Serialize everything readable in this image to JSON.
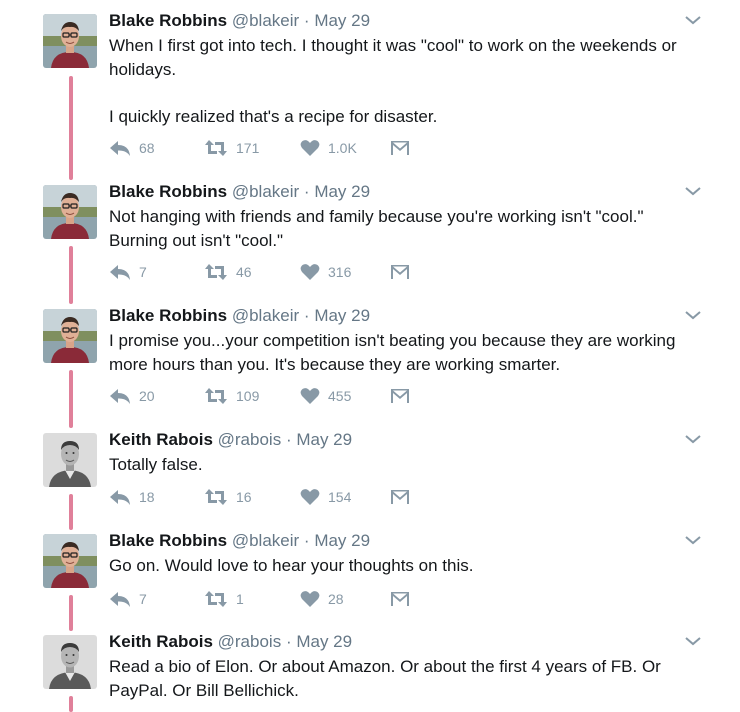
{
  "tweets": [
    {
      "name": "Blake Robbins",
      "handle": "@blakeir",
      "separator": "·",
      "date": "May 29",
      "text": "When I first got into tech. I thought it was \"cool\" to work on the weekends or holidays.\n\nI quickly realized that's a recipe for disaster.",
      "replies": "68",
      "retweets": "171",
      "likes": "1.0K",
      "avatar": "blake-avatar"
    },
    {
      "name": "Blake Robbins",
      "handle": "@blakeir",
      "separator": "·",
      "date": "May 29",
      "text": "Not hanging with friends and family because you're working isn't \"cool.\"\nBurning out isn't \"cool.\"",
      "replies": "7",
      "retweets": "46",
      "likes": "316",
      "avatar": "blake-avatar"
    },
    {
      "name": "Blake Robbins",
      "handle": "@blakeir",
      "separator": "·",
      "date": "May 29",
      "text": "I promise you...your competition isn't beating you because they are working\nmore hours than you. It's because they are working smarter.",
      "replies": "20",
      "retweets": "109",
      "likes": "455",
      "avatar": "blake-avatar"
    },
    {
      "name": "Keith Rabois",
      "handle": "@rabois",
      "separator": "·",
      "date": "May 29",
      "text": "Totally false.",
      "replies": "18",
      "retweets": "16",
      "likes": "154",
      "avatar": "keith-avatar"
    },
    {
      "name": "Blake Robbins",
      "handle": "@blakeir",
      "separator": "·",
      "date": "May 29",
      "text": "Go on. Would love to hear your thoughts on this.",
      "replies": "7",
      "retweets": "1",
      "likes": "28",
      "avatar": "blake-avatar"
    },
    {
      "name": "Keith Rabois",
      "handle": "@rabois",
      "separator": "·",
      "date": "May 29",
      "text": "Read a bio of Elon. Or about Amazon. Or about the first 4 years of FB.  Or\nPayPal.  Or Bill Bellichick.",
      "avatar": "keith-avatar"
    }
  ],
  "icons": {
    "reply": "reply-icon",
    "retweet": "retweet-icon",
    "like": "heart-icon",
    "dm": "envelope-icon",
    "more": "chevron-down-icon"
  },
  "colors": {
    "thread_line": "#e0809a",
    "name": "#14171a",
    "meta": "#657786",
    "action": "#8899a6"
  }
}
